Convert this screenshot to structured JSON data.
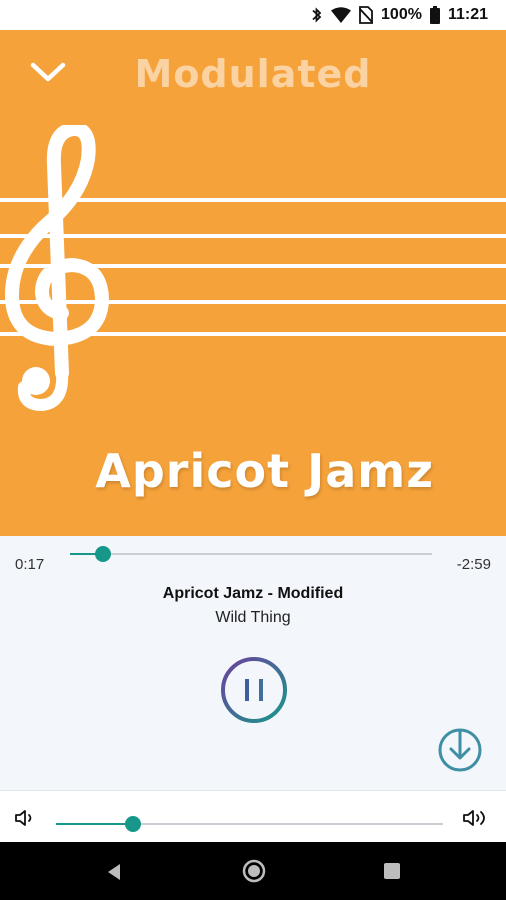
{
  "status_bar": {
    "battery_text": "100%",
    "time": "11:21",
    "icons": [
      "bluetooth-icon",
      "wifi-icon",
      "no-sim-icon",
      "battery-icon"
    ]
  },
  "artwork": {
    "title": "Modulated",
    "name": "Apricot Jamz",
    "background_color": "#F5A23A",
    "icons": [
      "chevron-down-icon",
      "treble-clef-icon"
    ]
  },
  "player": {
    "elapsed": "0:17",
    "remaining": "-2:59",
    "progress": 0.09,
    "track_title": "Apricot Jamz - Modified",
    "track_artist": "Wild Thing",
    "accent_color": "#17978A",
    "icons": [
      "pause-icon",
      "download-icon"
    ]
  },
  "volume": {
    "level": 0.2,
    "icons": [
      "volume-down-icon",
      "volume-up-icon"
    ]
  },
  "nav_bar": {
    "icons": [
      "back-icon",
      "home-icon",
      "recents-icon"
    ]
  }
}
